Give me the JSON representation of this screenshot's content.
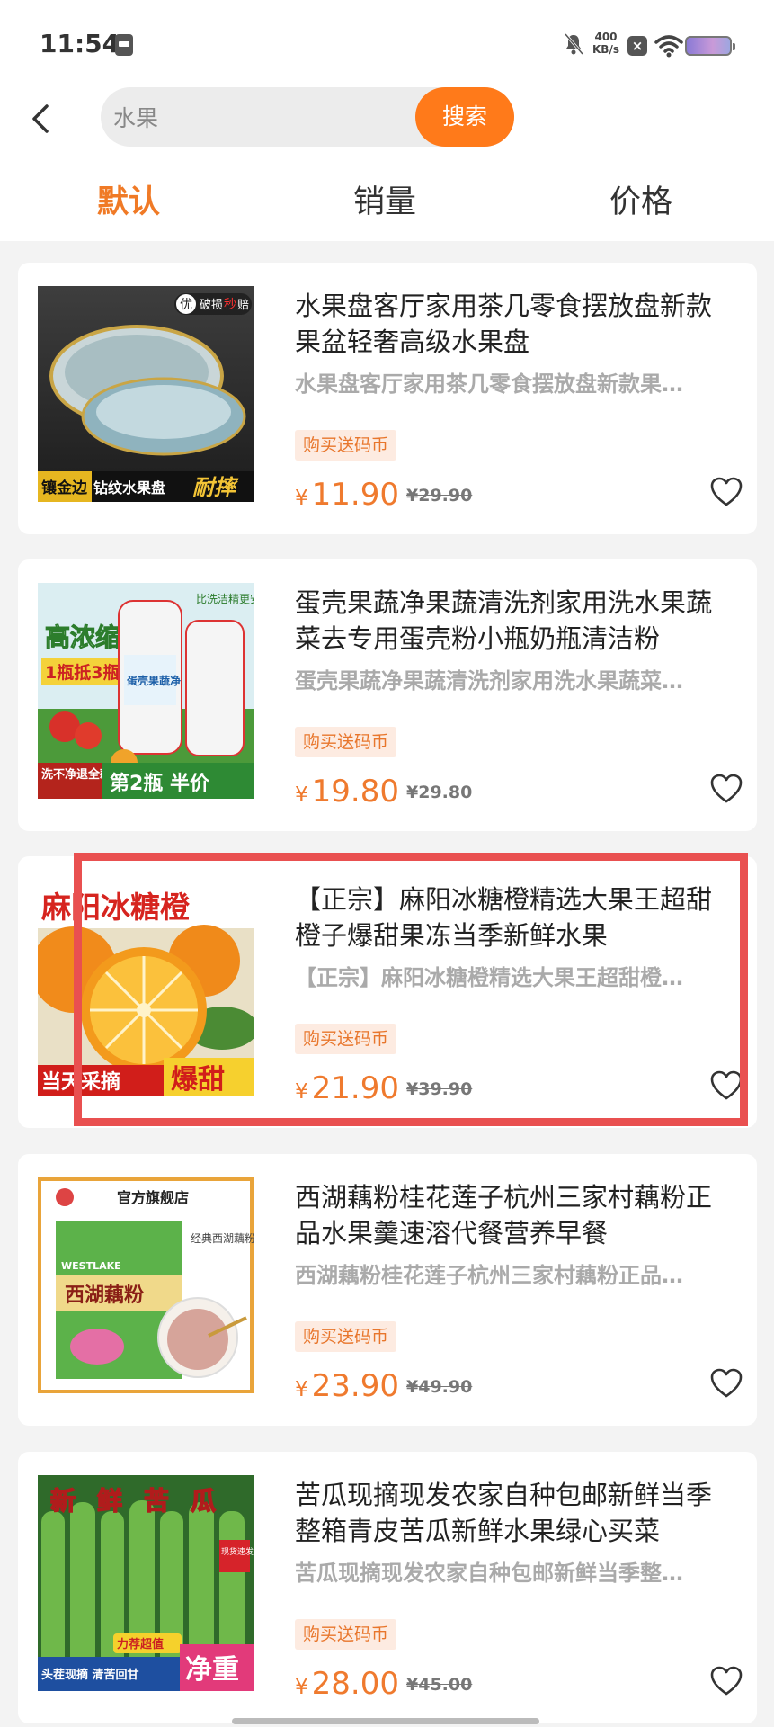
{
  "status_bar": {
    "time": "11:54",
    "speed_value": "400",
    "speed_unit": "KB/s",
    "battery_colors": [
      "#8a7ad6",
      "#c99ad8"
    ]
  },
  "search": {
    "value": "水果",
    "button_label": "搜索",
    "accent": "#ff7a1a"
  },
  "sort_tabs": [
    {
      "label": "默认",
      "active": true
    },
    {
      "label": "销量",
      "active": false
    },
    {
      "label": "价格",
      "active": false
    }
  ],
  "products": [
    {
      "title": "水果盘客厅家用茶几零食摆放盘新款果盆轻奢高级水果盘",
      "subtitle": "水果盘客厅家用茶几零食摆放盘新款果…",
      "badge": "购买送码币",
      "currency": "¥",
      "price": "11.90",
      "old_price": "¥29.90",
      "thumb": {
        "top_tag": "优",
        "top_tag2": "破损",
        "top_tag3": "秒",
        "top_tag4": "赔",
        "left_text": "镶金边",
        "mid_text": "钻纹水果盘",
        "right_text": "耐摔"
      }
    },
    {
      "title": "蛋壳果蔬净果蔬清洗剂家用洗水果蔬菜去专用蛋壳粉小瓶奶瓶清洁粉",
      "subtitle": "蛋壳果蔬净果蔬清洗剂家用洗水果蔬菜…",
      "badge": "购买送码币",
      "currency": "¥",
      "price": "19.80",
      "old_price": "¥29.80",
      "thumb": {
        "headline": "高浓缩",
        "sub": "1瓶抵3瓶",
        "bubble": "比洗洁精更安心",
        "bottle_label": "蛋壳果蔬净",
        "left_text": "洗不净退全款",
        "right_text": "第2瓶 半价"
      }
    },
    {
      "title": "【正宗】麻阳冰糖橙精选大果王超甜橙子爆甜果冻当季新鲜水果",
      "subtitle": "【正宗】麻阳冰糖橙精选大果王超甜橙…",
      "badge": "购买送码币",
      "currency": "¥",
      "price": "21.90",
      "old_price": "¥39.90",
      "thumb": {
        "headline": "麻阳冰糖橙",
        "left_text": "当天采摘",
        "right_text": "爆甜"
      }
    },
    {
      "title": "西湖藕粉桂花莲子杭州三家村藕粉正品水果羹速溶代餐营养早餐",
      "subtitle": "西湖藕粉桂花莲子杭州三家村藕粉正品…",
      "badge": "购买送码币",
      "currency": "¥",
      "price": "23.90",
      "old_price": "¥49.90",
      "thumb": {
        "store": "官方旗舰店",
        "brand_en": "WESTLAKE",
        "pack_name": "西湖藕粉",
        "side_text": "经典西湖藕粉"
      }
    },
    {
      "title": "苦瓜现摘现发农家自种包邮新鲜当季整箱青皮苦瓜新鲜水果绿心买菜",
      "subtitle": "苦瓜现摘现发农家自种包邮新鲜当季整…",
      "badge": "购买送码币",
      "currency": "¥",
      "price": "28.00",
      "old_price": "¥45.00",
      "thumb": {
        "chars": [
          "新",
          "鲜",
          "苦",
          "瓜"
        ],
        "tag": "现货速发",
        "promo": "力荐超值",
        "bottom_text": "头茬现摘 清苦回甘",
        "right_text": "净重"
      }
    }
  ],
  "colors": {
    "price": "#ef7a2e",
    "active_tab": "#f07a26",
    "highlight": "#e95050"
  }
}
